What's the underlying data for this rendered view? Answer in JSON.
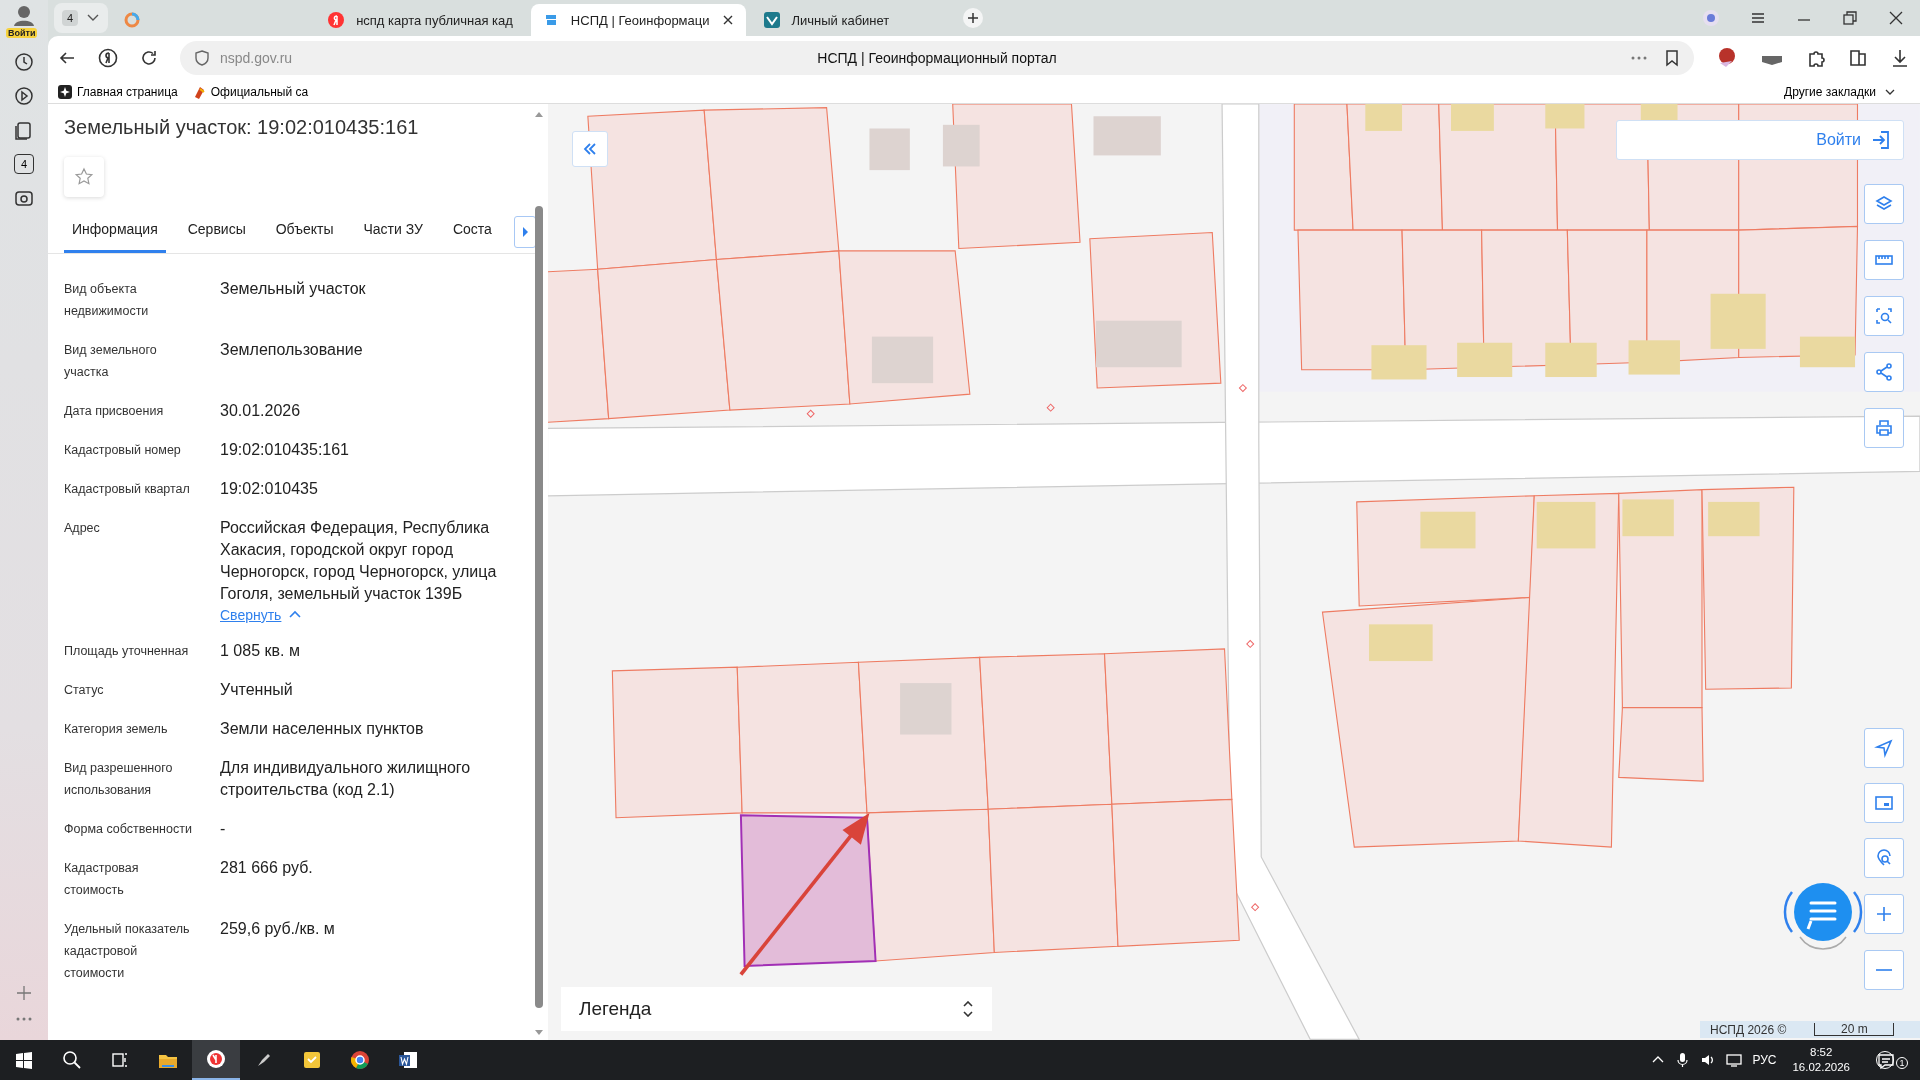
{
  "browser": {
    "profile_label": "Войти",
    "tab_counter": "4",
    "tabs": [
      {
        "kind": "pinned",
        "selected": false
      },
      {
        "kind": "search",
        "title": "нспд карта публичная кад",
        "selected": false
      },
      {
        "kind": "portal",
        "title": "НСПД | Геоинформаци",
        "selected": true
      },
      {
        "kind": "account",
        "title": "Личный кабинет",
        "selected": false
      }
    ],
    "address": "nspd.gov.ru",
    "page_title": "НСПД | Геоинформационный портал",
    "bookmarks": [
      "Главная страница",
      "Официальный са"
    ],
    "other_bookmarks": "Другие закладки",
    "rail_badge": "4"
  },
  "panel": {
    "title": "Земельный участок: 19:02:010435:161",
    "tabs": [
      {
        "label": "Информация",
        "selected": true
      },
      {
        "label": "Сервисы",
        "selected": false
      },
      {
        "label": "Объекты",
        "selected": false
      },
      {
        "label": "Части ЗУ",
        "selected": false
      },
      {
        "label": "Соста",
        "selected": false
      }
    ],
    "fields": [
      {
        "label": "Вид объекта недвижимости",
        "value": "Земельный участок"
      },
      {
        "label": "Вид земельного участка",
        "value": "Землепользование"
      },
      {
        "label": "Дата присвоения",
        "value": "30.01.2026"
      },
      {
        "label": "Кадастровый номер",
        "value": "19:02:010435:161"
      },
      {
        "label": "Кадастровый квартал",
        "value": "19:02:010435"
      },
      {
        "label": "Адрес",
        "value": "Российская Федерация, Республика Хакасия, городской округ город Черногорск, город Черногорск, улица Гоголя, земельный участок 139Б",
        "link": "Свернуть"
      },
      {
        "label": "Площадь уточненная",
        "value": "1 085 кв. м"
      },
      {
        "label": "Статус",
        "value": "Учтенный"
      },
      {
        "label": "Категория земель",
        "value": "Земли населенных пунктов"
      },
      {
        "label": "Вид разрешенного использования",
        "value": "Для индивидуального жилищного строительства (код 2.1)"
      },
      {
        "label": "Форма собственности",
        "value": "-"
      },
      {
        "label": "Кадастровая стоимость",
        "value": "281 666 руб."
      },
      {
        "label": "Удельный показатель кадастровой стоимости",
        "value": "259,6 руб./кв. м"
      }
    ]
  },
  "map": {
    "login": "Войти",
    "legend": "Легенда",
    "attribution": "НСПД 2026 ©",
    "scale": "20 m"
  },
  "taskbar": {
    "language": "РУС",
    "time": "8:52",
    "date": "16.02.2026",
    "notifications": "1"
  }
}
